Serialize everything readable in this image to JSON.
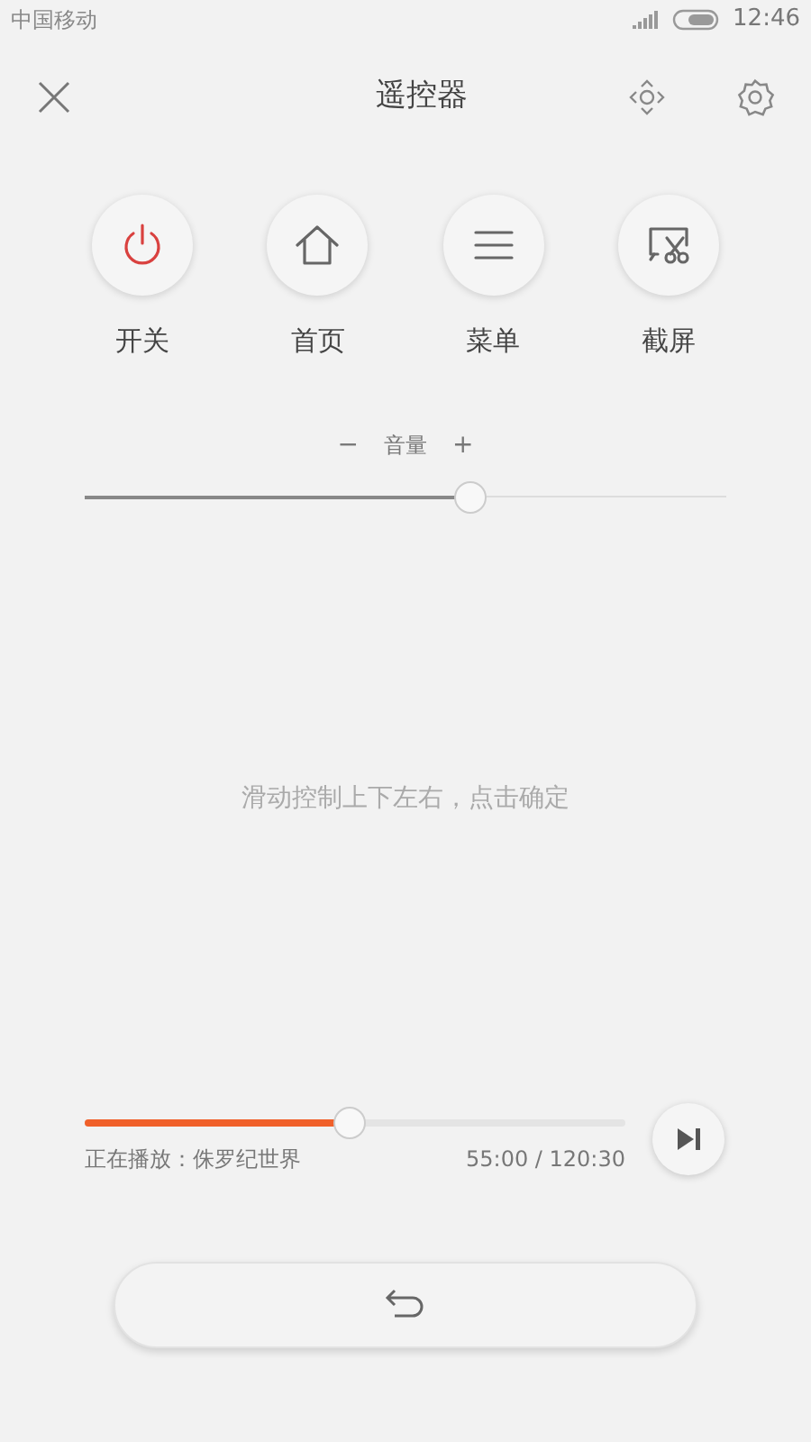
{
  "status_bar": {
    "carrier": "中国移动",
    "time": "12:46"
  },
  "header": {
    "title": "遥控器"
  },
  "shortcuts": [
    {
      "kind": "power",
      "label": "开关"
    },
    {
      "kind": "home",
      "label": "首页"
    },
    {
      "kind": "menu",
      "label": "菜单"
    },
    {
      "kind": "screenshot",
      "label": "截屏"
    }
  ],
  "volume": {
    "minus": "−",
    "label": "音量",
    "plus": "+",
    "level": 0.6
  },
  "touchpad": {
    "hint": "滑动控制上下左右，点击确定"
  },
  "playback": {
    "level": 0.49,
    "now_playing": "正在播放：侏罗纪世界",
    "time": "55:00 / 120:30"
  }
}
